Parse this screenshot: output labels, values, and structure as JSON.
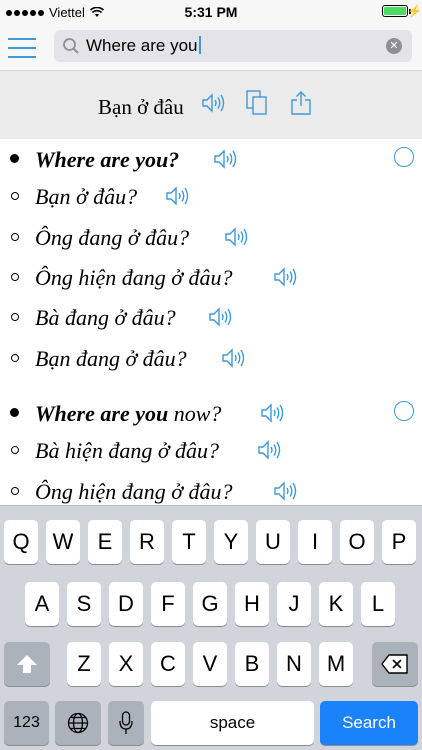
{
  "status": {
    "carrier": "Viettel",
    "time": "5:31 PM"
  },
  "search": {
    "value": "Where are you"
  },
  "translation": {
    "text": "Bạn ở đâu"
  },
  "results": [
    {
      "kind": "primary",
      "bold": "Where are you?",
      "rest": ""
    },
    {
      "kind": "secondary",
      "text": "Bạn ở đâu?"
    },
    {
      "kind": "secondary",
      "text": "Ông đang ở đâu?"
    },
    {
      "kind": "secondary",
      "text": "Ông hiện đang ở đâu?"
    },
    {
      "kind": "secondary",
      "text": "Bà đang ở đâu?"
    },
    {
      "kind": "secondary",
      "text": "Bạn đang ở đâu?"
    },
    {
      "kind": "primary",
      "bold": "Where are you",
      "rest": " now?"
    },
    {
      "kind": "secondary",
      "text": "Bà hiện đang ở đâu?"
    },
    {
      "kind": "secondary",
      "text": "Ông hiện đang ở đâu?"
    }
  ],
  "keyboard": {
    "row1": [
      "Q",
      "W",
      "E",
      "R",
      "T",
      "Y",
      "U",
      "I",
      "O",
      "P"
    ],
    "row2": [
      "A",
      "S",
      "D",
      "F",
      "G",
      "H",
      "J",
      "K",
      "L"
    ],
    "row3": [
      "Z",
      "X",
      "C",
      "V",
      "B",
      "N",
      "M"
    ],
    "numbers_label": "123",
    "space_label": "space",
    "search_label": "Search"
  },
  "colors": {
    "accent": "#3e9ad6",
    "search_key": "#1a82fb"
  }
}
